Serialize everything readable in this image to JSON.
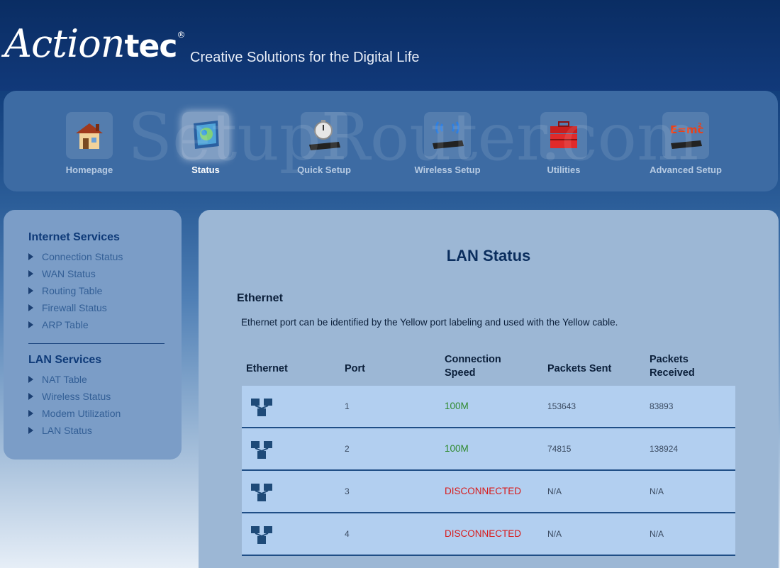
{
  "header": {
    "logo_script": "Action",
    "logo_bold": "tec",
    "logo_reg": "®",
    "tagline": "Creative Solutions for the Digital Life"
  },
  "watermark": "SetupRouter.com",
  "nav": {
    "items": [
      {
        "label": "Homepage",
        "icon": "house-icon",
        "active": false
      },
      {
        "label": "Status",
        "icon": "status-monitor-icon",
        "active": true
      },
      {
        "label": "Quick Setup",
        "icon": "stopwatch-router-icon",
        "active": false
      },
      {
        "label": "Wireless Setup",
        "icon": "wireless-router-icon",
        "active": false
      },
      {
        "label": "Utilities",
        "icon": "toolbox-icon",
        "active": false
      },
      {
        "label": "Advanced Setup",
        "icon": "emc2-router-icon",
        "active": false
      }
    ]
  },
  "sidebar": {
    "internet_heading": "Internet Services",
    "internet_items": [
      "Connection Status",
      "WAN Status",
      "Routing Table",
      "Firewall Status",
      "ARP Table"
    ],
    "lan_heading": "LAN Services",
    "lan_items": [
      "NAT Table",
      "Wireless Status",
      "Modem Utilization",
      "LAN Status"
    ]
  },
  "main": {
    "title": "LAN Status",
    "section_title": "Ethernet",
    "section_desc": "Ethernet port can be identified by the Yellow port labeling and used with the Yellow cable.",
    "table": {
      "headers": [
        "Ethernet",
        "Port",
        "Connection Speed",
        "Packets Sent",
        "Packets Received"
      ],
      "header_lines": [
        [
          "Ethernet"
        ],
        [
          "Port"
        ],
        [
          "Connection",
          "Speed"
        ],
        [
          "Packets Sent"
        ],
        [
          "Packets",
          "Received"
        ]
      ],
      "rows": [
        {
          "port": "1",
          "speed": "100M",
          "speed_status": "ok",
          "sent": "153643",
          "received": "83893"
        },
        {
          "port": "2",
          "speed": "100M",
          "speed_status": "ok",
          "sent": "74815",
          "received": "138924"
        },
        {
          "port": "3",
          "speed": "DISCONNECTED",
          "speed_status": "bad",
          "sent": "N/A",
          "received": "N/A"
        },
        {
          "port": "4",
          "speed": "DISCONNECTED",
          "speed_status": "bad",
          "sent": "N/A",
          "received": "N/A"
        }
      ]
    }
  },
  "colors": {
    "header_bg": "#0a2d63",
    "nav_bg": "#3d6ba3",
    "sidebar_bg": "#7b9dc7",
    "main_bg": "#9cb7d5",
    "row_bg": "#b2cff0",
    "speed_ok": "#2f8a2f",
    "speed_bad": "#d81b1b"
  }
}
